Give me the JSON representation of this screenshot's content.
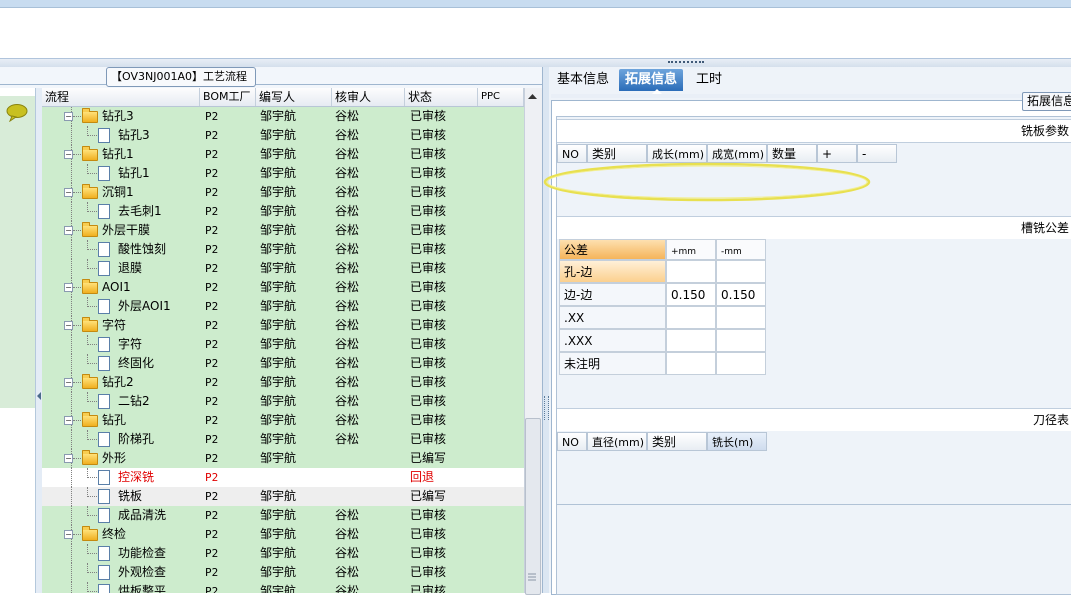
{
  "left_panel": {
    "title": "【OV3NJ001A0】工艺流程",
    "columns": [
      "流程",
      "BOM工厂",
      "编写人",
      "核审人",
      "状态",
      "PPC"
    ],
    "rows": [
      {
        "label": "钻孔3",
        "type": "folder",
        "level": 1,
        "bom": "P2",
        "writer": "邹宇航",
        "reviewer": "谷松",
        "status": "已审核",
        "style": "green"
      },
      {
        "label": "钻孔3",
        "type": "doc",
        "level": 2,
        "bom": "P2",
        "writer": "邹宇航",
        "reviewer": "谷松",
        "status": "已审核",
        "style": "green"
      },
      {
        "label": "钻孔1",
        "type": "folder",
        "level": 1,
        "bom": "P2",
        "writer": "邹宇航",
        "reviewer": "谷松",
        "status": "已审核",
        "style": "green"
      },
      {
        "label": "钻孔1",
        "type": "doc",
        "level": 2,
        "bom": "P2",
        "writer": "邹宇航",
        "reviewer": "谷松",
        "status": "已审核",
        "style": "green"
      },
      {
        "label": "沉铜1",
        "type": "folder",
        "level": 1,
        "bom": "P2",
        "writer": "邹宇航",
        "reviewer": "谷松",
        "status": "已审核",
        "style": "green"
      },
      {
        "label": "去毛刺1",
        "type": "doc",
        "level": 2,
        "bom": "P2",
        "writer": "邹宇航",
        "reviewer": "谷松",
        "status": "已审核",
        "style": "green"
      },
      {
        "label": "外层干膜",
        "type": "folder",
        "level": 1,
        "bom": "P2",
        "writer": "邹宇航",
        "reviewer": "谷松",
        "status": "已审核",
        "style": "green"
      },
      {
        "label": "酸性蚀刻",
        "type": "doc",
        "level": 2,
        "bom": "P2",
        "writer": "邹宇航",
        "reviewer": "谷松",
        "status": "已审核",
        "style": "green"
      },
      {
        "label": "退膜",
        "type": "doc",
        "level": 2,
        "bom": "P2",
        "writer": "邹宇航",
        "reviewer": "谷松",
        "status": "已审核",
        "style": "green"
      },
      {
        "label": "AOI1",
        "type": "folder",
        "level": 1,
        "bom": "P2",
        "writer": "邹宇航",
        "reviewer": "谷松",
        "status": "已审核",
        "style": "green"
      },
      {
        "label": "外层AOI1",
        "type": "doc",
        "level": 2,
        "bom": "P2",
        "writer": "邹宇航",
        "reviewer": "谷松",
        "status": "已审核",
        "style": "green"
      },
      {
        "label": "字符",
        "type": "folder",
        "level": 1,
        "bom": "P2",
        "writer": "邹宇航",
        "reviewer": "谷松",
        "status": "已审核",
        "style": "green"
      },
      {
        "label": "字符",
        "type": "doc",
        "level": 2,
        "bom": "P2",
        "writer": "邹宇航",
        "reviewer": "谷松",
        "status": "已审核",
        "style": "green"
      },
      {
        "label": "终固化",
        "type": "doc",
        "level": 2,
        "bom": "P2",
        "writer": "邹宇航",
        "reviewer": "谷松",
        "status": "已审核",
        "style": "green"
      },
      {
        "label": "钻孔2",
        "type": "folder",
        "level": 1,
        "bom": "P2",
        "writer": "邹宇航",
        "reviewer": "谷松",
        "status": "已审核",
        "style": "green"
      },
      {
        "label": "二钻2",
        "type": "doc",
        "level": 2,
        "bom": "P2",
        "writer": "邹宇航",
        "reviewer": "谷松",
        "status": "已审核",
        "style": "green"
      },
      {
        "label": "钻孔",
        "type": "folder",
        "level": 1,
        "bom": "P2",
        "writer": "邹宇航",
        "reviewer": "谷松",
        "status": "已审核",
        "style": "green"
      },
      {
        "label": "阶梯孔",
        "type": "doc",
        "level": 2,
        "bom": "P2",
        "writer": "邹宇航",
        "reviewer": "谷松",
        "status": "已审核",
        "style": "green"
      },
      {
        "label": "外形",
        "type": "folder",
        "level": 1,
        "bom": "P2",
        "writer": "邹宇航",
        "reviewer": "",
        "status": "已编写",
        "style": "green"
      },
      {
        "label": "控深铣",
        "type": "doc",
        "level": 2,
        "bom": "P2",
        "writer": "",
        "reviewer": "",
        "status": "回退",
        "style": "white",
        "red": true
      },
      {
        "label": "铣板",
        "type": "doc",
        "level": 2,
        "bom": "P2",
        "writer": "邹宇航",
        "reviewer": "",
        "status": "已编写",
        "style": "sel"
      },
      {
        "label": "成品清洗",
        "type": "doc",
        "level": 2,
        "bom": "P2",
        "writer": "邹宇航",
        "reviewer": "谷松",
        "status": "已审核",
        "style": "green"
      },
      {
        "label": "终检",
        "type": "folder",
        "level": 1,
        "bom": "P2",
        "writer": "邹宇航",
        "reviewer": "谷松",
        "status": "已审核",
        "style": "green"
      },
      {
        "label": "功能检查",
        "type": "doc",
        "level": 2,
        "bom": "P2",
        "writer": "邹宇航",
        "reviewer": "谷松",
        "status": "已审核",
        "style": "green"
      },
      {
        "label": "外观检查",
        "type": "doc",
        "level": 2,
        "bom": "P2",
        "writer": "邹宇航",
        "reviewer": "谷松",
        "status": "已审核",
        "style": "green"
      },
      {
        "label": "烘板整平",
        "type": "doc",
        "level": 2,
        "bom": "P2",
        "writer": "邹宇航",
        "reviewer": "谷松",
        "status": "已审核",
        "style": "green"
      }
    ]
  },
  "tabs": [
    {
      "label": "基本信息",
      "active": false
    },
    {
      "label": "拓展信息",
      "active": true
    },
    {
      "label": "工时",
      "active": false
    }
  ],
  "right_panel": {
    "ext_button": "拓展信息",
    "mill_params": {
      "title": "铣板参数",
      "columns": [
        "NO",
        "类别",
        "成长(mm)",
        "成宽(mm)",
        "数量",
        "+",
        "-"
      ]
    },
    "tolerance": {
      "title": "槽铣公差",
      "header": [
        "公差",
        "+mm",
        "-mm"
      ],
      "rows": [
        {
          "label": "孔-边",
          "plus": "",
          "minus": ""
        },
        {
          "label": "边-边",
          "plus": "0.150",
          "minus": "0.150"
        },
        {
          "label": ".XX",
          "plus": "",
          "minus": ""
        },
        {
          "label": ".XXX",
          "plus": "",
          "minus": ""
        },
        {
          "label": "未注明",
          "plus": "",
          "minus": ""
        }
      ]
    },
    "cutter": {
      "title": "刀径表",
      "columns": [
        "NO",
        "直径(mm)",
        "类别",
        "铣长(m)"
      ]
    }
  },
  "colors": {
    "row_green": "#cdeccd",
    "active_tab": "#2a6cb8",
    "highlight_ellipse": "#e8e050",
    "return_red": "#e00000"
  }
}
